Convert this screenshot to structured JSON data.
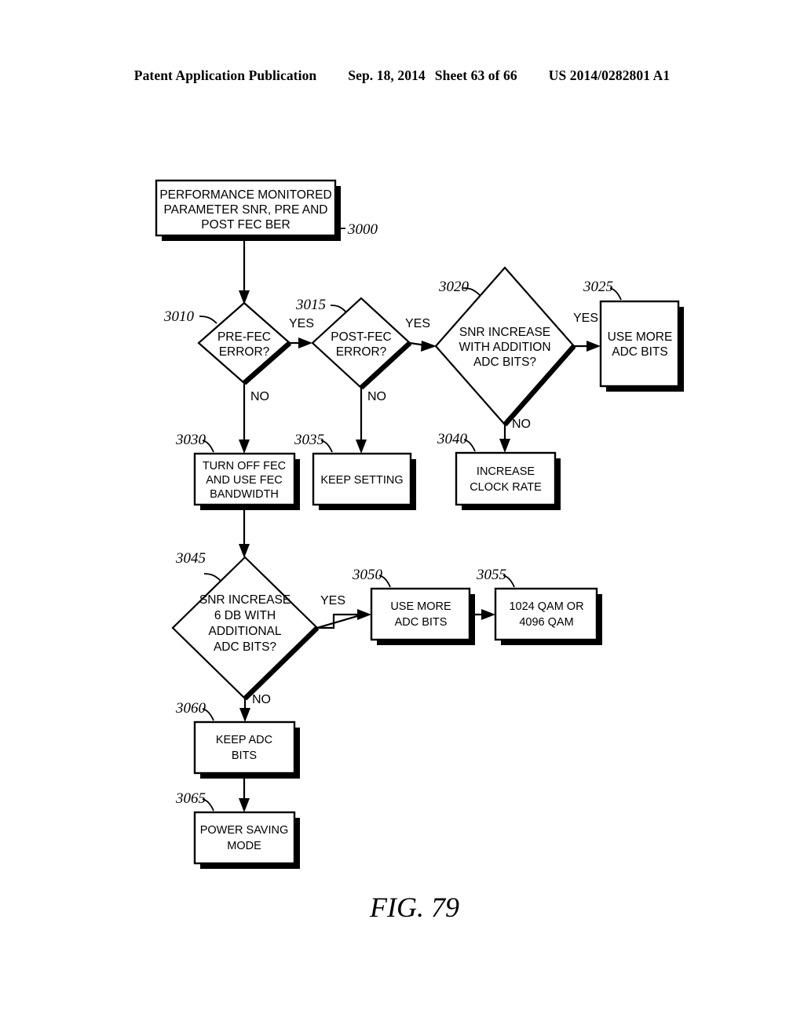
{
  "header": {
    "publication": "Patent Application Publication",
    "date": "Sep. 18, 2014",
    "sheet": "Sheet 63 of 66",
    "patent_number": "US 2014/0282801 A1"
  },
  "figure": {
    "caption": "FIG. 79"
  },
  "nodes": {
    "n3000": {
      "ref": "3000",
      "lines": [
        "PERFORMANCE MONITORED",
        "PARAMETER SNR, PRE AND",
        "POST FEC BER"
      ]
    },
    "n3010": {
      "ref": "3010",
      "lines": [
        "PRE-FEC",
        "ERROR?"
      ]
    },
    "n3015": {
      "ref": "3015",
      "lines": [
        "POST-FEC",
        "ERROR?"
      ]
    },
    "n3020": {
      "ref": "3020",
      "lines": [
        "SNR INCREASE",
        "WITH ADDITION",
        "ADC BITS?"
      ]
    },
    "n3025": {
      "ref": "3025",
      "lines": [
        "USE MORE",
        "ADC BITS"
      ]
    },
    "n3030": {
      "ref": "3030",
      "lines": [
        "TURN OFF FEC",
        "AND USE FEC",
        "BANDWIDTH"
      ]
    },
    "n3035": {
      "ref": "3035",
      "lines": [
        "KEEP SETTING"
      ]
    },
    "n3040": {
      "ref": "3040",
      "lines": [
        "INCREASE",
        "CLOCK RATE"
      ]
    },
    "n3045": {
      "ref": "3045",
      "lines": [
        "SNR INCREASE",
        "6 DB WITH",
        "ADDITIONAL",
        "ADC BITS?"
      ]
    },
    "n3050": {
      "ref": "3050",
      "lines": [
        "USE MORE",
        "ADC BITS"
      ]
    },
    "n3055": {
      "ref": "3055",
      "lines": [
        "1024 QAM OR",
        "4096 QAM"
      ]
    },
    "n3060": {
      "ref": "3060",
      "lines": [
        "KEEP ADC",
        "BITS"
      ]
    },
    "n3065": {
      "ref": "3065",
      "lines": [
        "POWER SAVING",
        "MODE"
      ]
    }
  },
  "branches": {
    "yes_3010": "YES",
    "no_3010": "NO",
    "yes_3015": "YES",
    "no_3015": "NO",
    "yes_3020": "YES",
    "no_3020": "NO",
    "yes_3045": "YES",
    "no_3045": "NO"
  },
  "colors": {
    "ink": "#000000",
    "paper": "#ffffff"
  }
}
